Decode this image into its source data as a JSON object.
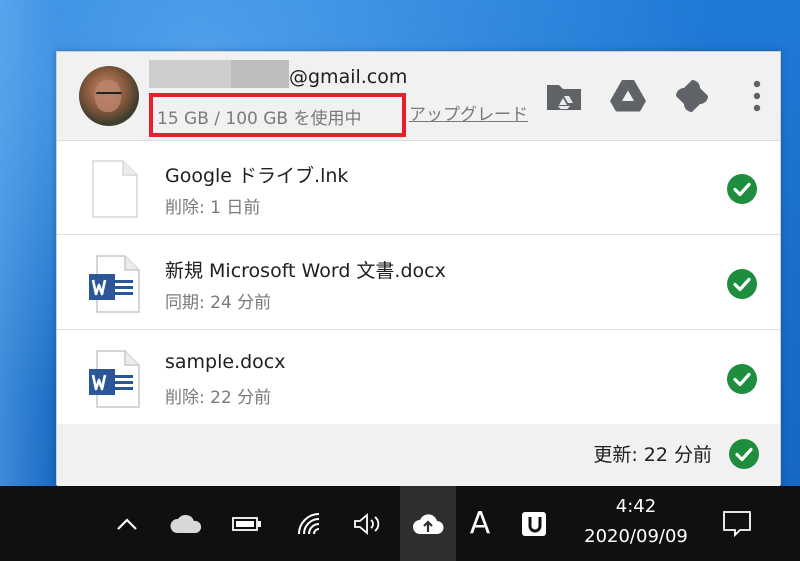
{
  "account": {
    "email_suffix": "@gmail.com",
    "usage": "15 GB / 100 GB を使用中",
    "upgrade_label": "アップグレード"
  },
  "header_icons": [
    "drive-folder-icon",
    "google-drive-icon",
    "google-photos-icon",
    "more-vert-icon"
  ],
  "files": [
    {
      "name": "Google ドライブ.lnk",
      "status": "削除: 1 日前",
      "icon": "generic-file-icon"
    },
    {
      "name": "新規 Microsoft Word 文書.docx",
      "status": "同期: 24 分前",
      "icon": "word-file-icon"
    },
    {
      "name": "sample.docx",
      "status": "削除: 22 分前",
      "icon": "word-file-icon"
    }
  ],
  "footer": {
    "updated": "更新: 22 分前"
  },
  "taskbar": {
    "ime_label": "A",
    "time": "4:42",
    "date": "2020/09/09"
  },
  "colors": {
    "highlight_box": "#e5202a",
    "sync_check": "#1e8e3e",
    "word_blue": "#2b579a",
    "desktop": "#1a6fc9"
  }
}
